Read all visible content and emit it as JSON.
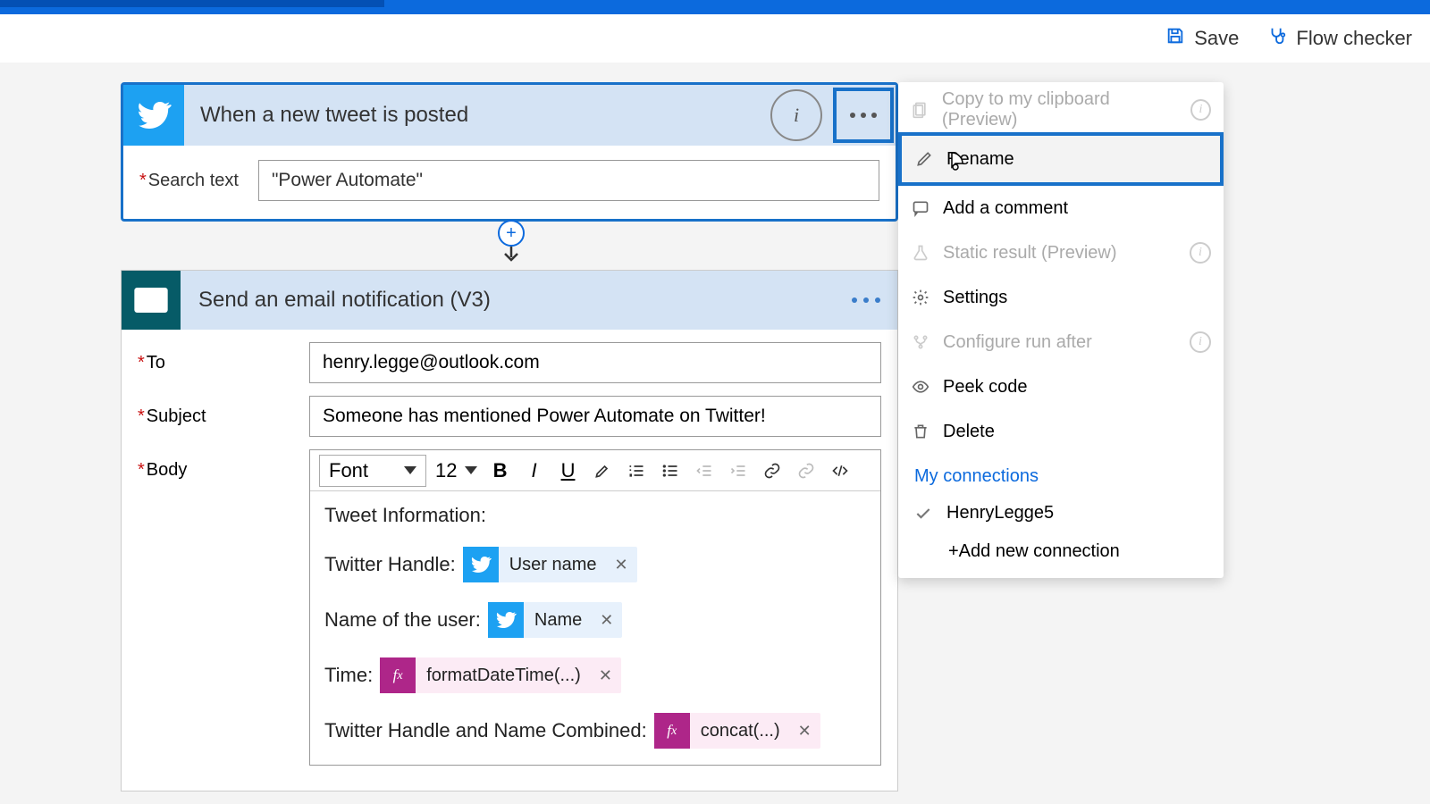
{
  "toolbar": {
    "save_label": "Save",
    "flow_checker_label": "Flow checker"
  },
  "trigger": {
    "title": "When a new tweet is posted",
    "search_label": "Search text",
    "search_value": "\"Power Automate\""
  },
  "action": {
    "title": "Send an email notification (V3)",
    "to_label": "To",
    "to_value": "henry.legge@outlook.com",
    "subject_label": "Subject",
    "subject_value": "Someone has mentioned Power Automate on Twitter!",
    "body_label": "Body",
    "font_label": "Font",
    "font_size": "12",
    "body_intro": "Tweet Information:",
    "line1_label": "Twitter Handle:",
    "token1": "User name",
    "line2_label": "Name of the user:",
    "token2": "Name",
    "line3_label": "Time:",
    "token3": "formatDateTime(...)",
    "line4_label": "Twitter Handle and Name Combined:",
    "token4": "concat(...)"
  },
  "menu": {
    "copy": "Copy to my clipboard (Preview)",
    "rename": "Rename",
    "add_comment": "Add a comment",
    "static_result": "Static result (Preview)",
    "settings": "Settings",
    "configure_run_after": "Configure run after",
    "peek_code": "Peek code",
    "delete": "Delete",
    "my_connections": "My connections",
    "connection_name": "HenryLegge5",
    "add_connection": "+Add new connection"
  }
}
